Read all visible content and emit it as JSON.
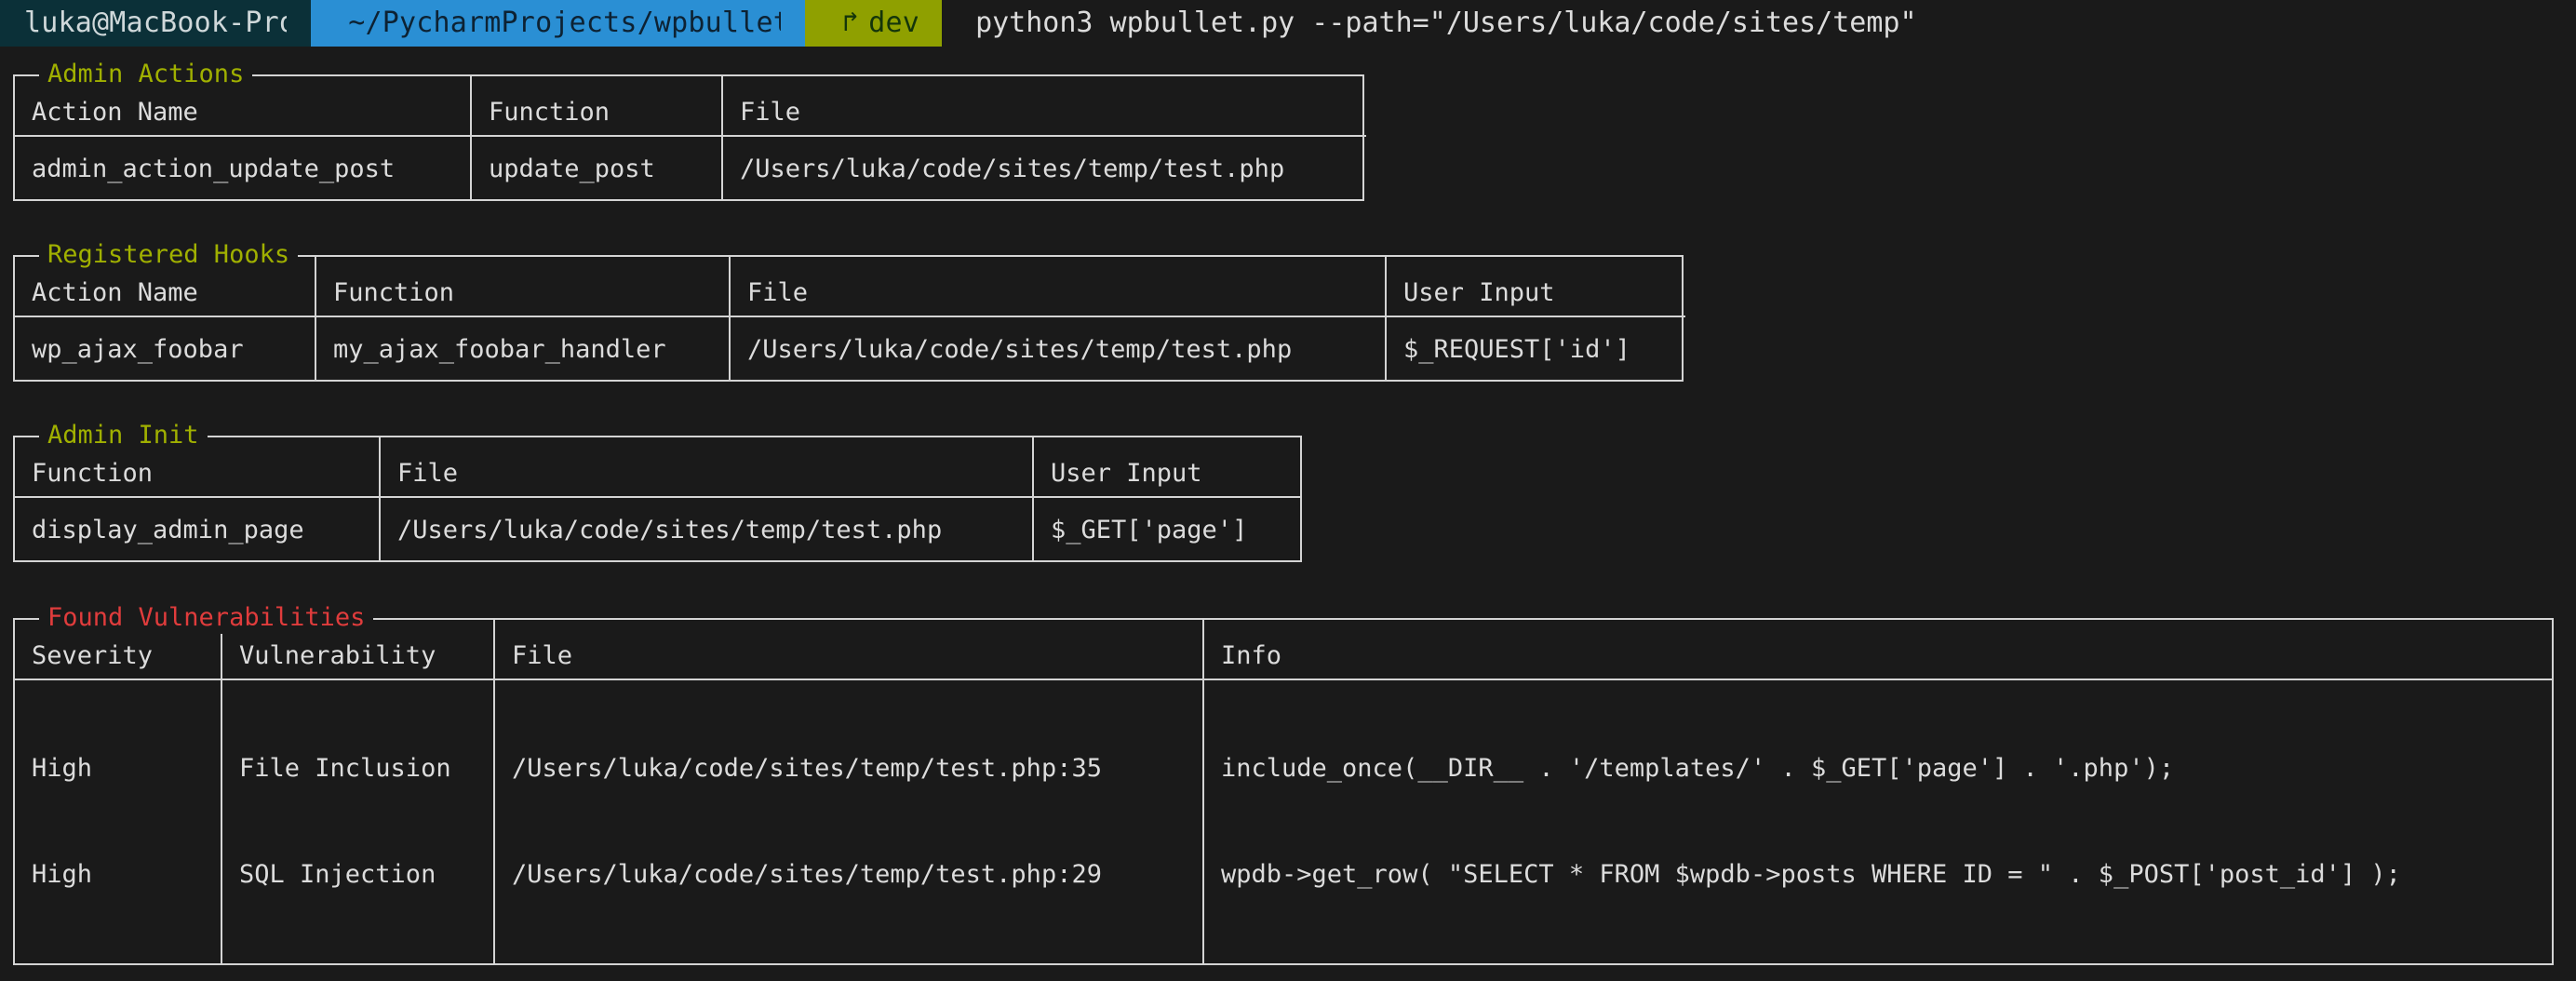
{
  "prompt": {
    "host": "luka@MacBook-Pro",
    "path": "~/PycharmProjects/wpbullet",
    "git_glyph": "↱",
    "git_branch": "dev",
    "command": "python3 wpbullet.py --path=\"/Users/luka/code/sites/temp\""
  },
  "colors": {
    "background": "#1a1a1a",
    "foreground": "#dcdcdc",
    "border": "#d4d4d4",
    "host_bg": "#0b3038",
    "path_bg": "#2a8fd4",
    "git_bg": "#8fa000",
    "title_olive": "#a0b000",
    "title_red": "#e03c3c"
  },
  "panels": [
    {
      "id": "admin-actions",
      "title": "Admin Actions",
      "title_color": "olive",
      "columns": [
        "Action Name",
        "Function",
        "File"
      ],
      "col_widths": [
        "283px",
        "148px",
        "394px"
      ],
      "rows": [
        [
          "admin_action_update_post",
          "update_post",
          "/Users/luka/code/sites/temp/test.php"
        ]
      ]
    },
    {
      "id": "registered-hooks",
      "title": "Registered Hooks",
      "title_color": "olive",
      "columns": [
        "Action Name",
        "Function",
        "File"
      ],
      "col_widths": [
        "184px",
        "250px",
        "400px",
        "184px"
      ],
      "extra_column": "User Input",
      "rows": [
        [
          "wp_ajax_foobar",
          "my_ajax_foobar_handler",
          "/Users/luka/code/sites/temp/test.php",
          "$_REQUEST['id']"
        ]
      ]
    },
    {
      "id": "admin-init",
      "title": "Admin Init",
      "title_color": "olive",
      "columns": [
        "Function",
        "File",
        "User Input"
      ],
      "col_widths": [
        "222px",
        "398px",
        "163px"
      ],
      "rows": [
        [
          "display_admin_page",
          "/Users/luka/code/sites/temp/test.php",
          "$_GET['page']"
        ]
      ]
    },
    {
      "id": "found-vulnerabilities",
      "title": "Found Vulnerabilities",
      "title_color": "red",
      "columns": [
        "Severity",
        "Vulnerability",
        "File",
        "Info"
      ],
      "col_widths": [
        "125px",
        "165px",
        "430px",
        "826px"
      ],
      "rows": [
        {
          "severity": [
            "High",
            "High"
          ],
          "vulnerability": [
            "File Inclusion",
            "SQL Injection"
          ],
          "file": [
            "/Users/luka/code/sites/temp/test.php:35",
            "/Users/luka/code/sites/temp/test.php:29"
          ],
          "info": [
            "include_once(__DIR__ . '/templates/' . $_GET['page'] . '.php');",
            "wpdb->get_row( \"SELECT * FROM $wpdb->posts WHERE ID = \" . $_POST['post_id'] );"
          ]
        }
      ]
    }
  ]
}
